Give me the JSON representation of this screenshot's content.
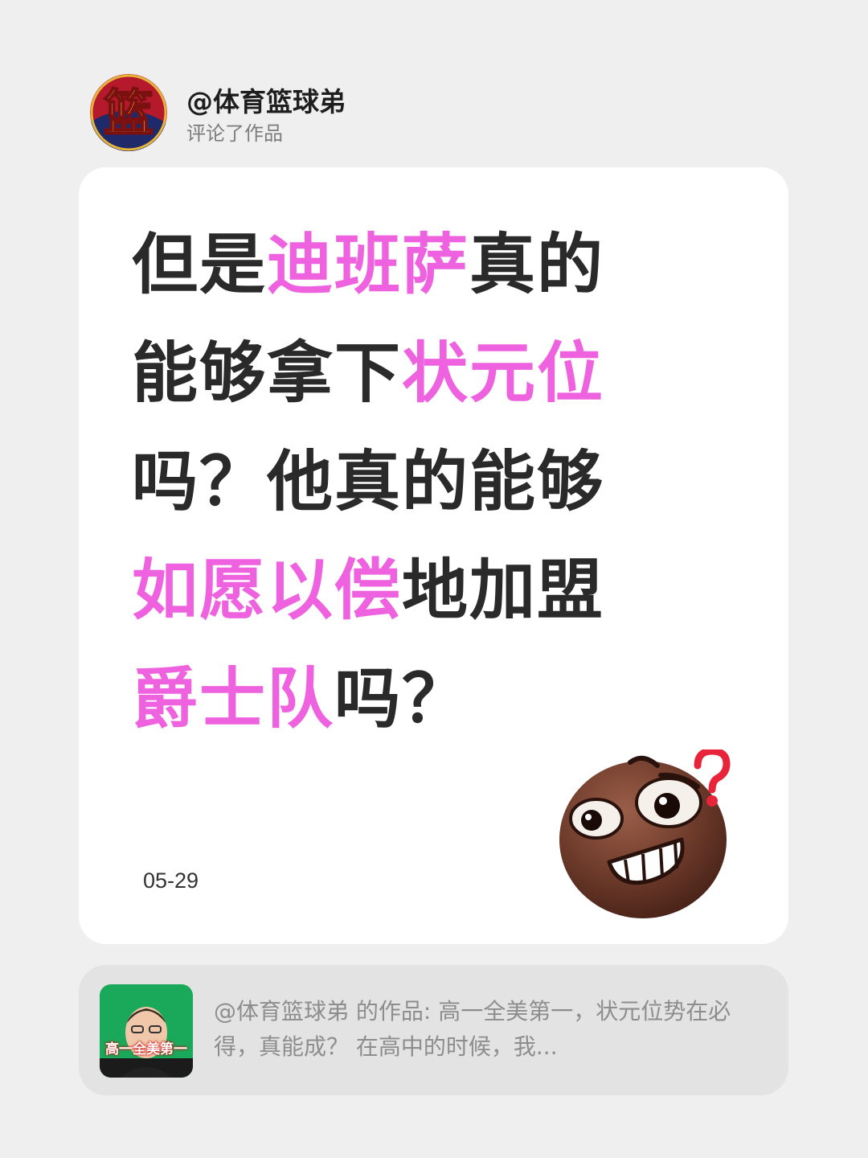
{
  "header": {
    "username": "@体育篮球弟",
    "action": "评论了作品",
    "avatar_glyph": "篮",
    "avatar_icon": "basketball-logo-avatar"
  },
  "comment": {
    "lines": [
      [
        {
          "t": "但是",
          "hl": false
        },
        {
          "t": "迪班萨",
          "hl": true
        },
        {
          "t": "真的",
          "hl": false
        }
      ],
      [
        {
          "t": "能够拿下",
          "hl": false
        },
        {
          "t": "状元位",
          "hl": true
        }
      ],
      [
        {
          "t": "吗？他真的能够",
          "hl": false
        }
      ],
      [
        {
          "t": "如愿以偿",
          "hl": true
        },
        {
          "t": "地加盟",
          "hl": false
        }
      ],
      [
        {
          "t": "爵士队",
          "hl": true
        },
        {
          "t": "吗？",
          "hl": false
        }
      ]
    ],
    "date": "05-29",
    "emoji": "confused-grinning-face-emoji"
  },
  "work": {
    "thumbnail_caption": "高一全美第一",
    "text": "@体育篮球弟 的作品: 高一全美第一，状元位势在必得，真能成？ 在高中的时候，我..."
  },
  "colors": {
    "background": "#efefef",
    "card": "#ffffff",
    "highlight": "#ef62df",
    "text": "#2a2a2a",
    "muted": "#8d8d8d"
  }
}
